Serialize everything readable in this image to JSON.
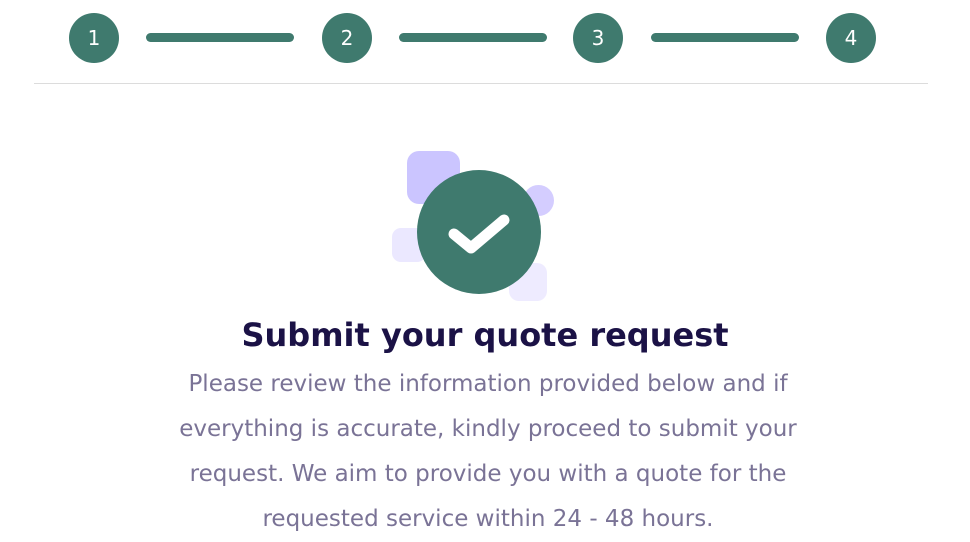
{
  "stepper": {
    "steps": [
      "1",
      "2",
      "3",
      "4"
    ],
    "accent_color": "#3f7a6e"
  },
  "illustration": {
    "icon": "checkmark-icon"
  },
  "content": {
    "title": "Submit your quote request",
    "description": "Please review the information provided below and if everything is accurate, kindly proceed to submit your request. We aim to provide you with a quote for the requested service within 24 - 48 hours."
  }
}
